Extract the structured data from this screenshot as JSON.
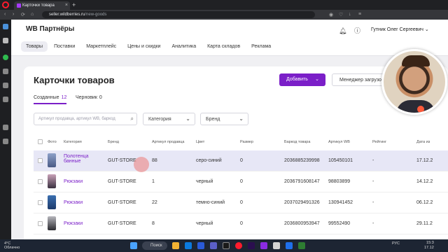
{
  "browser": {
    "tab_title": "Карточки товара",
    "new_tab": "+",
    "url_domain": "seller.wildberries.ru",
    "url_path": "/new-goods"
  },
  "header": {
    "logo": "WB Партнёры",
    "user_name": "Гутник Олег Сергеевич"
  },
  "nav": {
    "tabs": [
      "Товары",
      "Поставки",
      "Маркетплейс",
      "Цены и скидки",
      "Аналитика",
      "Карта складов",
      "Реклама"
    ],
    "active_index": 0
  },
  "main": {
    "title": "Карточки товаров",
    "add_button": "Добавить",
    "manager_button": "Менеджер загрузок",
    "subtabs": [
      {
        "label": "Созданные",
        "count": "12"
      },
      {
        "label": "Черновик",
        "count": "0"
      }
    ],
    "search_placeholder": "Артикул продавца, артикул WB, баркод",
    "category_dropdown": "Категория",
    "brand_dropdown": "Бренд"
  },
  "table": {
    "columns": [
      "Фото",
      "Категория",
      "Бренд",
      "Артикул продавца",
      "Цвет",
      "Размер",
      "Баркод товара",
      "Артикул WB",
      "Рейтинг",
      "Дата из"
    ],
    "rows": [
      {
        "category": "Полотенца банные",
        "brand": "GUT-STORE",
        "article": "88",
        "color": "серо-синий",
        "size": "0",
        "barcode": "2036885239998",
        "wb_article": "105450101",
        "rating": "-",
        "date": "17.12.2"
      },
      {
        "category": "Рюкзаки",
        "brand": "GUT-STORE",
        "article": "1",
        "color": "черный",
        "size": "0",
        "barcode": "2036791608147",
        "wb_article": "98803899",
        "rating": "-",
        "date": "14.12.2"
      },
      {
        "category": "Рюкзаки",
        "brand": "GUT-STORE",
        "article": "22",
        "color": "темно-синий",
        "size": "0",
        "barcode": "2037029491326",
        "wb_article": "130941452",
        "rating": "-",
        "date": "06.12.2"
      },
      {
        "category": "Рюкзаки",
        "brand": "GUT-STORE",
        "article": "8",
        "color": "черный",
        "size": "0",
        "barcode": "2036800953947",
        "wb_article": "99552490",
        "rating": "-",
        "date": "29.11.2"
      }
    ]
  },
  "taskbar": {
    "temp": "4°C",
    "weather": "Облачно",
    "search": "Поиск",
    "lang": "РУС",
    "time": "15:3",
    "date": "17.12"
  },
  "colors": {
    "accent": "#7b1fc8",
    "row_highlight": "#e7e7f6"
  }
}
